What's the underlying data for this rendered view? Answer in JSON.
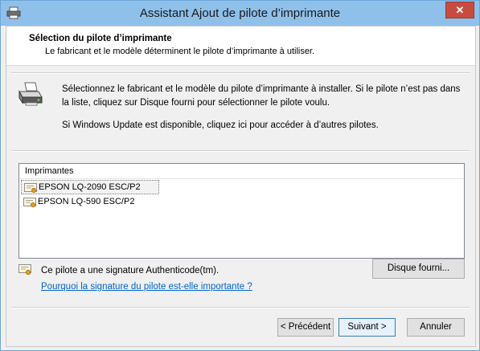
{
  "window": {
    "title": "Assistant Ajout de pilote d’imprimante",
    "close_label": "✕"
  },
  "header": {
    "title": "Sélection du pilote d’imprimante",
    "subtitle": "Le fabricant et le modèle déterminent le pilote d’imprimante à utiliser."
  },
  "intro": {
    "line1": "Sélectionnez le fabricant et le modèle du pilote d’imprimante à installer. Si le pilote n’est pas dans la liste, cliquez sur Disque fourni pour sélectionner le pilote voulu.",
    "line2": "Si Windows Update est disponible, cliquez ici pour accéder à d’autres pilotes."
  },
  "printers": {
    "header": "Imprimantes",
    "items": [
      {
        "label": "EPSON LQ-2090 ESC/P2",
        "selected": true
      },
      {
        "label": "EPSON LQ-590 ESC/P2",
        "selected": false
      }
    ]
  },
  "signature": {
    "text": "Ce pilote a une signature Authenticode(tm).",
    "link": "Pourquoi la signature du pilote est-elle importante ?"
  },
  "buttons": {
    "disk": "Disque fourni...",
    "previous": "< Précédent",
    "next": "Suivant >",
    "cancel": "Annuler"
  },
  "icons": {
    "title": "printer-icon",
    "wizard": "printer-icon",
    "driver": "certificate-icon",
    "signature": "certificate-icon"
  }
}
